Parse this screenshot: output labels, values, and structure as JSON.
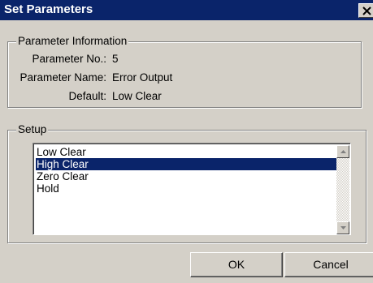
{
  "window": {
    "title": "Set Parameters",
    "close_symbol": "close-icon"
  },
  "parameter_information": {
    "legend": "Parameter Information",
    "rows": [
      {
        "label": "Parameter No.:",
        "value": "5"
      },
      {
        "label": "Parameter Name:",
        "value": "Error Output"
      },
      {
        "label": "Default:",
        "value": "Low Clear"
      }
    ]
  },
  "setup": {
    "legend": "Setup",
    "options": [
      "Low Clear",
      "High Clear",
      "Zero Clear",
      "Hold"
    ],
    "selected": "High Clear"
  },
  "buttons": {
    "ok_label": "OK",
    "cancel_label": "Cancel"
  },
  "colors": {
    "titlebar": "#0a246a",
    "face": "#d4d0c8",
    "selection": "#0a246a"
  }
}
